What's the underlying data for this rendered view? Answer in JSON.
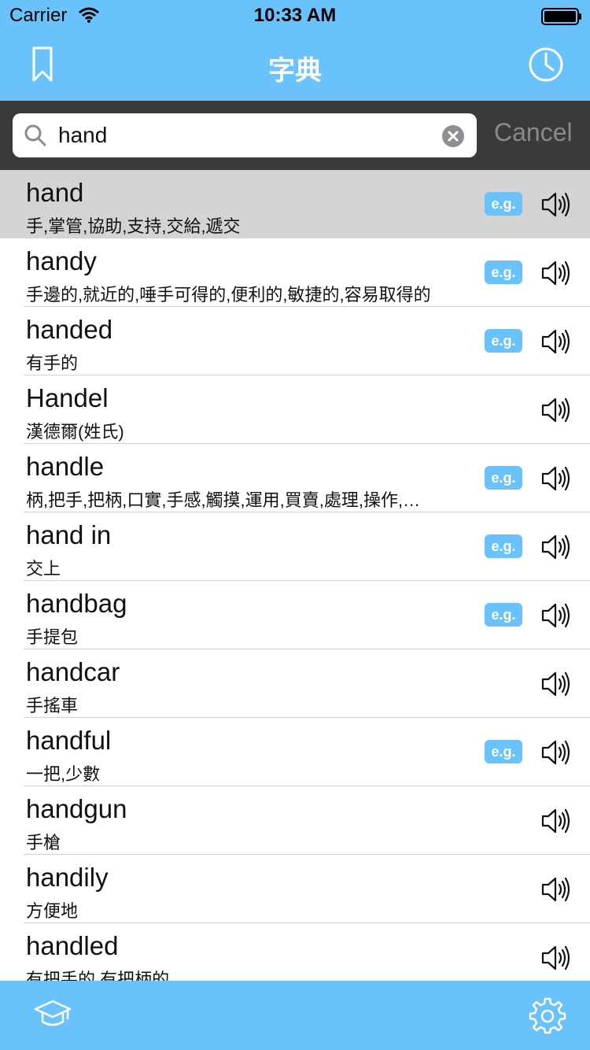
{
  "status_bar": {
    "carrier": "Carrier",
    "time": "10:33 AM"
  },
  "nav": {
    "title": "字典",
    "left_icon": "bookmark-icon",
    "right_icon": "clock-icon"
  },
  "search": {
    "value": "hand",
    "cancel_label": "Cancel"
  },
  "colors": {
    "accent": "#69c3fa",
    "search_bg": "#3a3a3a",
    "selected_row": "#d4d4d4"
  },
  "results": [
    {
      "word": "hand",
      "definition": "手,掌管,協助,支持,交給,遞交",
      "has_example": true,
      "selected": true
    },
    {
      "word": "handy",
      "definition": "手邊的,就近的,唾手可得的,便利的,敏捷的,容易取得的",
      "has_example": true
    },
    {
      "word": "handed",
      "definition": "有手的",
      "has_example": true
    },
    {
      "word": "Handel",
      "definition": "漢德爾(姓氏)",
      "has_example": false
    },
    {
      "word": "handle",
      "definition": "柄,把手,把柄,口實,手感,觸摸,運用,買賣,處理,操作,…",
      "has_example": true
    },
    {
      "word": "hand in",
      "definition": "交上",
      "has_example": true
    },
    {
      "word": "handbag",
      "definition": "手提包",
      "has_example": true
    },
    {
      "word": "handcar",
      "definition": "手搖車",
      "has_example": false
    },
    {
      "word": "handful",
      "definition": "一把,少數",
      "has_example": true
    },
    {
      "word": "handgun",
      "definition": "手槍",
      "has_example": false
    },
    {
      "word": "handily",
      "definition": "方便地",
      "has_example": false
    },
    {
      "word": "handled",
      "definition": "有把手的,有把柄的",
      "has_example": false
    }
  ],
  "example_badge": "e.g.",
  "tabbar": {
    "left_icon": "graduation-cap-icon",
    "right_icon": "gear-icon"
  }
}
